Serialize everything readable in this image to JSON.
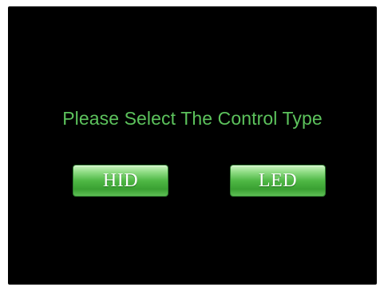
{
  "prompt": {
    "text": "Please Select The Control Type"
  },
  "buttons": {
    "hid_label": "HID",
    "led_label": "LED"
  },
  "colors": {
    "background": "#000000",
    "prompt_text": "#5cc25c",
    "button_green": "#4fb845",
    "button_text": "#ffffff"
  }
}
